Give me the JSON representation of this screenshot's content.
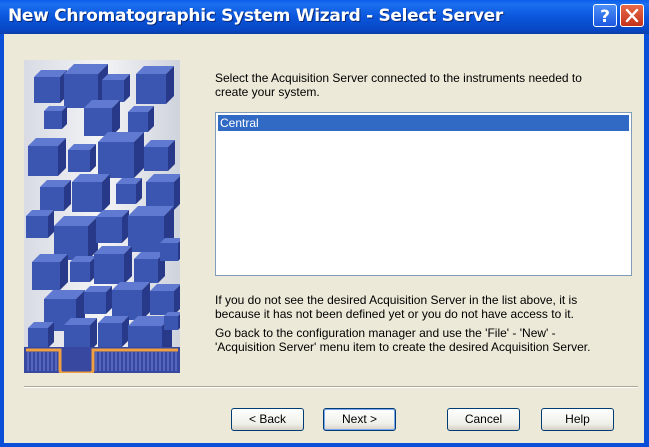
{
  "window": {
    "title": "New Chromatographic System Wizard - Select Server",
    "help_glyph": "?",
    "close_icon": "close-icon"
  },
  "colors": {
    "titlebar": "#0a56dc",
    "selection": "#316ac5",
    "dialog_bg": "#ece9d8",
    "art_cube": "#3b56b0"
  },
  "intro": {
    "line1": "Select the Acquisition Server connected to the instruments needed to",
    "line2": "create your system."
  },
  "server_list": {
    "items": [
      "Central"
    ],
    "selected": "Central"
  },
  "notes": {
    "p1_line1": "If you do not see the desired Acquisition Server in the list above, it is",
    "p1_line2": "because it has not been defined yet or you do not have access to it.",
    "p2_line1": "Go back to the configuration manager and use the 'File' - 'New' -",
    "p2_line2": "'Acquisition Server' menu item to create the desired Acquisition Server."
  },
  "buttons": {
    "back": "< Back",
    "next": "Next >",
    "cancel": "Cancel",
    "help": "Help"
  }
}
